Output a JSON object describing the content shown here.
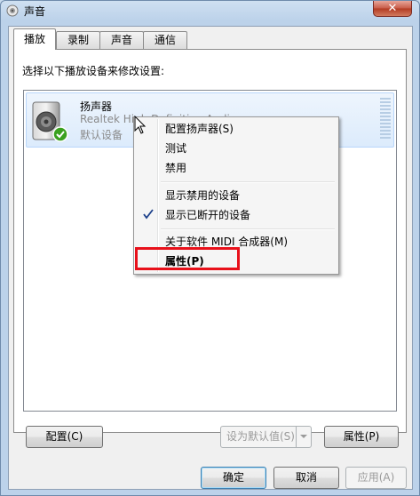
{
  "window": {
    "title": "声音",
    "close_glyph": "✕"
  },
  "tabs": [
    {
      "label": "播放",
      "active": true
    },
    {
      "label": "录制",
      "active": false
    },
    {
      "label": "声音",
      "active": false
    },
    {
      "label": "通信",
      "active": false
    }
  ],
  "instruction": "选择以下播放设备来修改设置:",
  "device": {
    "name": "扬声器",
    "driver": "Realtek High Definition Audio",
    "status": "默认设备",
    "icon": "speaker-icon",
    "status_icon": "check-badge-icon"
  },
  "context_menu": {
    "items": [
      {
        "label": "配置扬声器(S)"
      },
      {
        "label": "测试"
      },
      {
        "label": "禁用"
      },
      {
        "label": "显示禁用的设备"
      },
      {
        "label": "显示已断开的设备",
        "checked": true
      },
      {
        "label": "关于软件 MIDI 合成器(M)"
      },
      {
        "label": "属性(P)",
        "bold": true,
        "highlighted": true
      }
    ]
  },
  "buttons": {
    "configure": "配置(C)",
    "set_default": "设为默认值(S)",
    "properties": "属性(P)",
    "ok": "确定",
    "cancel": "取消",
    "apply": "应用(A)"
  },
  "colors": {
    "highlight_border": "#e8101a",
    "title_bar": "#bcd2ea",
    "selection": "#dcebfc"
  }
}
